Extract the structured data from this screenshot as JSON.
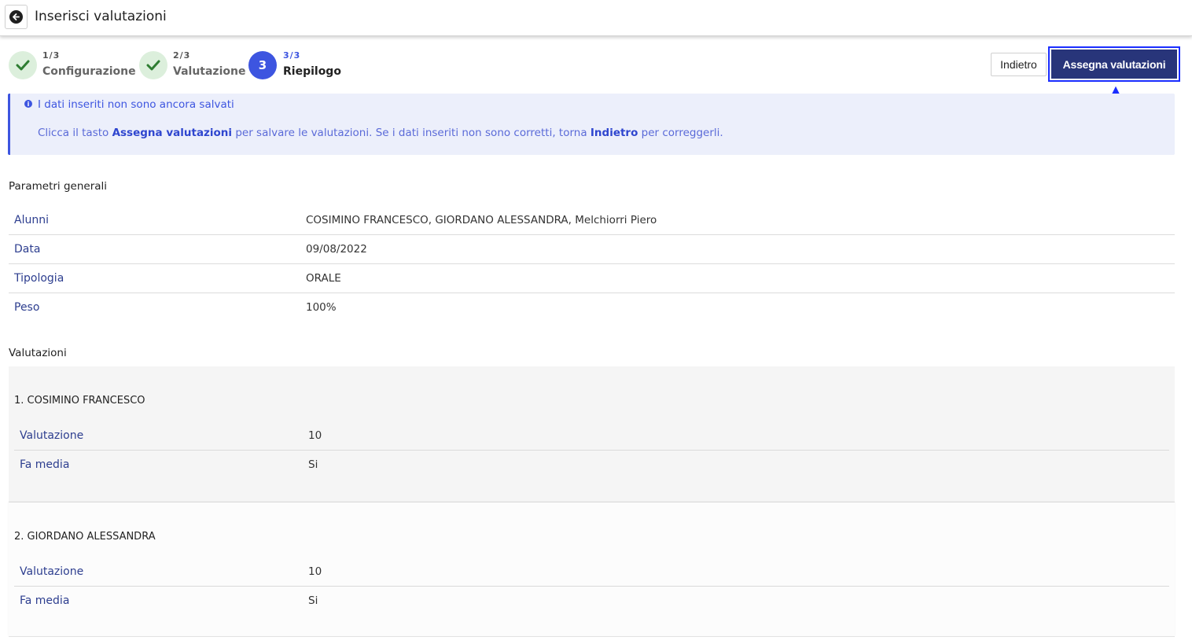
{
  "header": {
    "title": "Inserisci valutazioni",
    "back_icon": "arrow-left-circle-icon"
  },
  "stepper": [
    {
      "num": "1/3",
      "label": "Configurazione",
      "state": "done"
    },
    {
      "num": "2/3",
      "label": "Valutazione",
      "state": "done"
    },
    {
      "num": "3/3",
      "label": "Riepilogo",
      "state": "current",
      "badge": "3"
    }
  ],
  "actions": {
    "back_label": "Indietro",
    "submit_label": "Assegna valutazioni"
  },
  "info": {
    "title": "I dati inseriti non sono ancora salvati",
    "text_1": "Clicca il tasto ",
    "text_bold_1": "Assegna valutazioni",
    "text_2": " per salvare le valutazioni. Se i dati inseriti non sono corretti, torna ",
    "text_bold_2": "Indietro",
    "text_3": " per correggerli."
  },
  "general": {
    "title": "Parametri generali",
    "rows": [
      {
        "key": "Alunni",
        "value": "COSIMINO FRANCESCO, GIORDANO ALESSANDRA, Melchiorri Piero"
      },
      {
        "key": "Data",
        "value": "09/08/2022"
      },
      {
        "key": "Tipologia",
        "value": "ORALE"
      },
      {
        "key": "Peso",
        "value": "100%"
      }
    ]
  },
  "valutazioni": {
    "title": "Valutazioni",
    "students": [
      {
        "name": "1. COSIMINO FRANCESCO",
        "rows": [
          {
            "key": "Valutazione",
            "value": "10"
          },
          {
            "key": "Fa media",
            "value": "Si"
          }
        ]
      },
      {
        "name": "2. GIORDANO ALESSANDRA",
        "rows": [
          {
            "key": "Valutazione",
            "value": "10"
          },
          {
            "key": "Fa media",
            "value": "Si"
          }
        ]
      }
    ]
  },
  "colors": {
    "accent": "#3d55e0",
    "primary_button": "#28357a",
    "highlight_border": "#1a2dff",
    "done_badge": "#dcefdc",
    "check": "#2e7d32"
  }
}
